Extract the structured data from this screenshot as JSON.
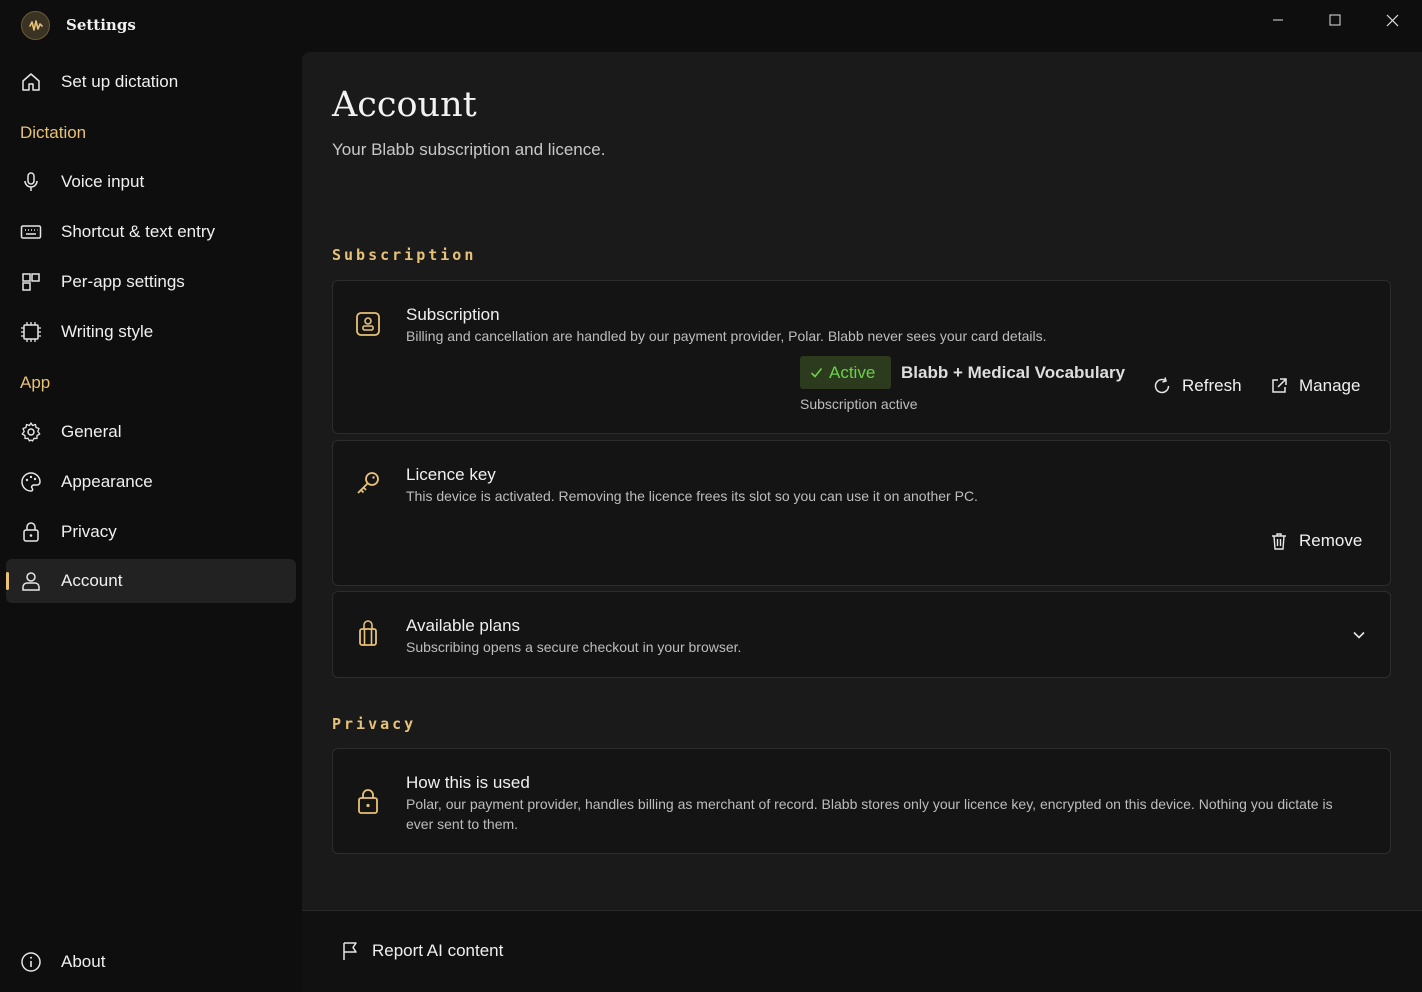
{
  "window": {
    "title": "Settings"
  },
  "sidebar": {
    "setup_label": "Set up dictation",
    "sections": {
      "dictation": "Dictation",
      "app": "App"
    },
    "items": [
      {
        "label": "Voice input"
      },
      {
        "label": "Shortcut & text entry"
      },
      {
        "label": "Per-app settings"
      },
      {
        "label": "Writing style"
      },
      {
        "label": "General"
      },
      {
        "label": "Appearance"
      },
      {
        "label": "Privacy"
      },
      {
        "label": "Account"
      }
    ],
    "about_label": "About",
    "active_item": "Account"
  },
  "page": {
    "title": "Account",
    "subtitle": "Your Blabb subscription and licence."
  },
  "sections": {
    "subscription": "Subscription",
    "privacy": "Privacy"
  },
  "subscription_card": {
    "title": "Subscription",
    "description": "Billing and cancellation are handled by our payment provider, Polar. Blabb never sees your card details.",
    "badge": "Active",
    "plan": "Blabb + Medical Vocabulary",
    "status": "Subscription active",
    "refresh_label": "Refresh",
    "manage_label": "Manage"
  },
  "licence_card": {
    "title": "Licence key",
    "description": "This device is activated. Removing the licence frees its slot so you can use it on another PC.",
    "remove_label": "Remove"
  },
  "plans_card": {
    "title": "Available plans",
    "description": "Subscribing opens a secure checkout in your browser."
  },
  "privacy_card": {
    "title": "How this is used",
    "description": "Polar, our payment provider, handles billing as merchant of record. Blabb stores only your licence key, encrypted on this device. Nothing you dictate is ever sent to them."
  },
  "footer": {
    "report_label": "Report AI content"
  },
  "colors": {
    "accent": "#e7c277",
    "active_green": "#6bd14a",
    "badge_bg": "#2c3a1e"
  }
}
